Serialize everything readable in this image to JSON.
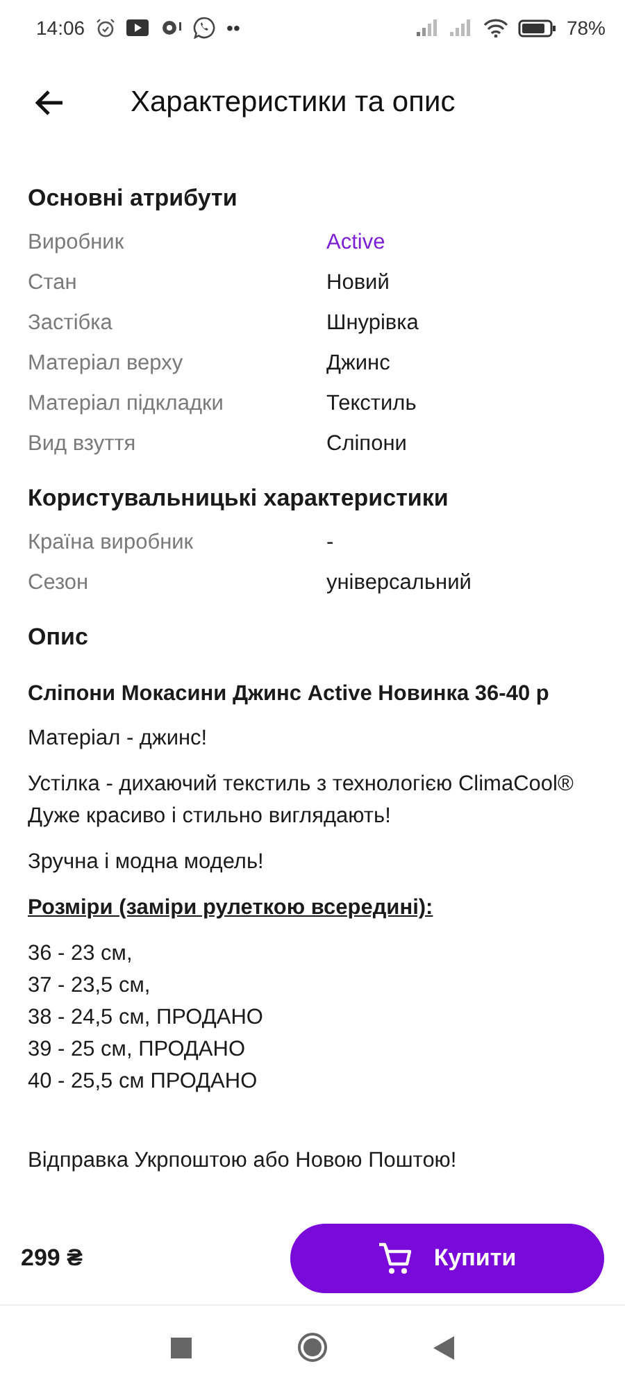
{
  "status_bar": {
    "time": "14:06",
    "more": "••",
    "battery_percent": "78%"
  },
  "header": {
    "title": "Характеристики та опис"
  },
  "sections": [
    {
      "title": "Основні атрибути",
      "rows": [
        {
          "label": "Виробник",
          "value": "Active",
          "kind": "link"
        },
        {
          "label": "Стан",
          "value": "Новий",
          "kind": "text"
        },
        {
          "label": "Застібка",
          "value": "Шнурівка",
          "kind": "text"
        },
        {
          "label": "Матеріал верху",
          "value": "Джинс",
          "kind": "text"
        },
        {
          "label": "Матеріал підкладки",
          "value": "Текстиль",
          "kind": "text"
        },
        {
          "label": "Вид взуття",
          "value": "Сліпони",
          "kind": "text"
        }
      ]
    },
    {
      "title": "Користувальницькі характеристики",
      "rows": [
        {
          "label": "Країна виробник",
          "value": "-",
          "kind": "text"
        },
        {
          "label": "Сезон",
          "value": "універсальний",
          "kind": "text"
        }
      ]
    }
  ],
  "description": {
    "title": "Опис",
    "blocks": [
      {
        "kind": "title",
        "text": "Сліпони Мокасини Джинс Active Новинка 36-40 р"
      },
      {
        "kind": "paragraph",
        "text": "Матеріал - джинс!"
      },
      {
        "kind": "paragraph",
        "text": "Устілка - дихаючий текстиль з технологією ClimaCool®\nДуже красиво і стильно виглядають!"
      },
      {
        "kind": "paragraph",
        "text": "Зручна і модна модель!"
      },
      {
        "kind": "heading",
        "text": "Розміри (заміри рулеткою всередині):"
      },
      {
        "kind": "paragraph",
        "text": "36 - 23 см,\n37 - 23,5 см,\n38 - 24,5 см, ПРОДАНО\n39 - 25 см, ПРОДАНО\n40 - 25,5 см ПРОДАНО"
      },
      {
        "kind": "spacer_paragraph",
        "text": "Відправка Укрпоштою або Новою Поштою!"
      }
    ]
  },
  "buy_bar": {
    "price": "299 ₴",
    "button": "Купити"
  }
}
